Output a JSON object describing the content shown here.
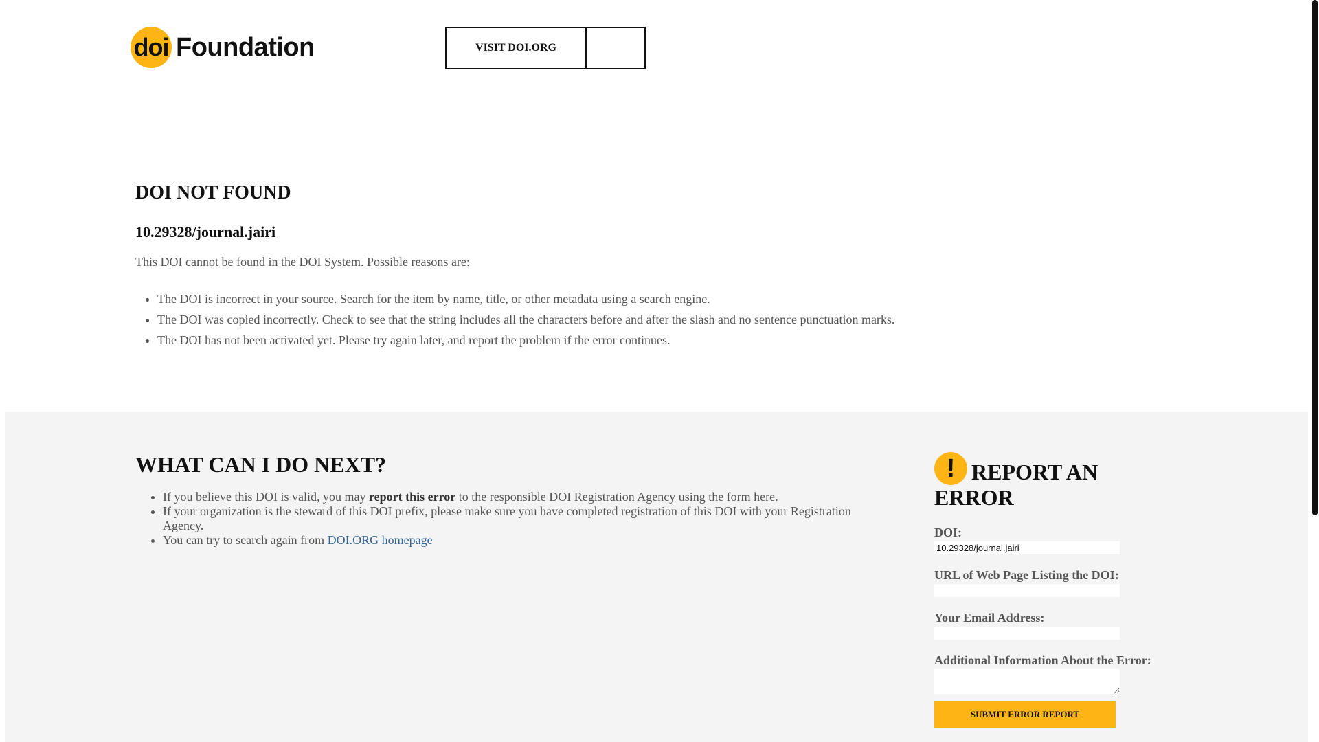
{
  "colors": {
    "accent": "#fcb514",
    "grey_bg": "#f4f4f4",
    "link": "#336699"
  },
  "header": {
    "logo": {
      "mark": "doi",
      "word": "Foundation"
    },
    "visit_button": "VISIT DOI.ORG"
  },
  "main": {
    "title": "DOI NOT FOUND",
    "doi": "10.29328/journal.jairi",
    "intro": "This DOI cannot be found in the DOI System. Possible reasons are:",
    "reasons": [
      "The DOI is incorrect in your source. Search for the item by name, title, or other metadata using a search engine.",
      "The DOI was copied incorrectly. Check to see that the string includes all the characters before and after the slash and no sentence punctuation marks.",
      "The DOI has not been activated yet. Please try again later, and report the problem if the error continues."
    ]
  },
  "next": {
    "title": "WHAT CAN I DO NEXT?",
    "item1": {
      "before": "If you believe this DOI is valid, you may ",
      "bold": "report this error",
      "after": " to the responsible DOI Registration Agency using the form here."
    },
    "item2": "If your organization is the steward of this DOI prefix, please make sure you have completed registration of this DOI with your Registration Agency.",
    "item3": {
      "before": "You can try to search again from ",
      "link": "DOI.ORG homepage"
    }
  },
  "report": {
    "icon": "exclamation-icon",
    "title": "REPORT AN ERROR",
    "doi_label": "DOI:",
    "doi_value": "10.29328/journal.jairi",
    "url_label": "URL of Web Page Listing the DOI:",
    "url_value": "",
    "email_label": "Your Email Address:",
    "email_value": "",
    "info_label": "Additional Information About the Error:",
    "info_value": "",
    "submit": "SUBMIT ERROR REPORT"
  }
}
